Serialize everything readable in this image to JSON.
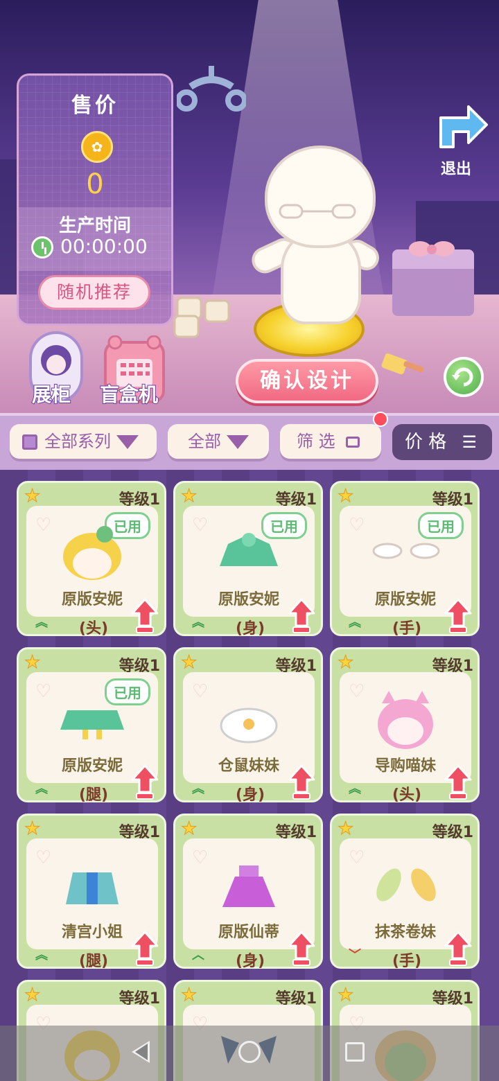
{
  "price_panel": {
    "title": "售价",
    "price": "0",
    "production_label": "生产时间",
    "production_time": "00:00:00",
    "random_button": "随机推荐"
  },
  "exit": {
    "label": "退出"
  },
  "cabinet": {
    "label": "展柜"
  },
  "blind_box": {
    "label": "盲盒机"
  },
  "confirm_button": "确认设计",
  "filters": {
    "series": "全部系列",
    "all": "全部",
    "filter": "筛 选",
    "price": "价 格"
  },
  "items": [
    {
      "level": "等级1",
      "name": "原版安妮",
      "slot": "(头)",
      "used": "已用",
      "rank": "up2",
      "icon": "blonde-hair-icon"
    },
    {
      "level": "等级1",
      "name": "原版安妮",
      "slot": "(身)",
      "used": "已用",
      "rank": "up2",
      "icon": "green-dress-top-icon"
    },
    {
      "level": "等级1",
      "name": "原版安妮",
      "slot": "(手)",
      "used": "已用",
      "rank": "up2",
      "icon": "white-gloves-icon"
    },
    {
      "level": "等级1",
      "name": "原版安妮",
      "slot": "(腿)",
      "used": "已用",
      "rank": "up2",
      "icon": "green-skirt-icon"
    },
    {
      "level": "等级1",
      "name": "仓鼠妹妹",
      "slot": "(身)",
      "used": "",
      "rank": "up2",
      "icon": "fluffy-collar-icon"
    },
    {
      "level": "等级1",
      "name": "导购喵妹",
      "slot": "(头)",
      "used": "",
      "rank": "up2",
      "icon": "pink-cat-hair-icon"
    },
    {
      "level": "等级1",
      "name": "清宫小姐",
      "slot": "(腿)",
      "used": "",
      "rank": "up2",
      "icon": "striped-skirt-icon"
    },
    {
      "level": "等级1",
      "name": "原版仙蒂",
      "slot": "(身)",
      "used": "",
      "rank": "up1",
      "icon": "purple-dress-icon"
    },
    {
      "level": "等级1",
      "name": "抹茶卷妹",
      "slot": "(手)",
      "used": "",
      "rank": "down1",
      "icon": "matcha-roll-hands-icon"
    },
    {
      "level": "等级1",
      "name": "",
      "slot": "",
      "used": "",
      "rank": "",
      "icon": "yellow-hair-icon"
    },
    {
      "level": "等级1",
      "name": "",
      "slot": "",
      "used": "",
      "rank": "",
      "icon": "blue-horns-icon"
    },
    {
      "level": "等级1",
      "name": "",
      "slot": "",
      "used": "",
      "rank": "",
      "icon": "matcha-hood-icon"
    }
  ],
  "colors": {
    "card_bg": "#c8e0a3",
    "used_badge": "#5cba72",
    "confirm": "#f16a83",
    "price_text": "#ffd24a"
  }
}
